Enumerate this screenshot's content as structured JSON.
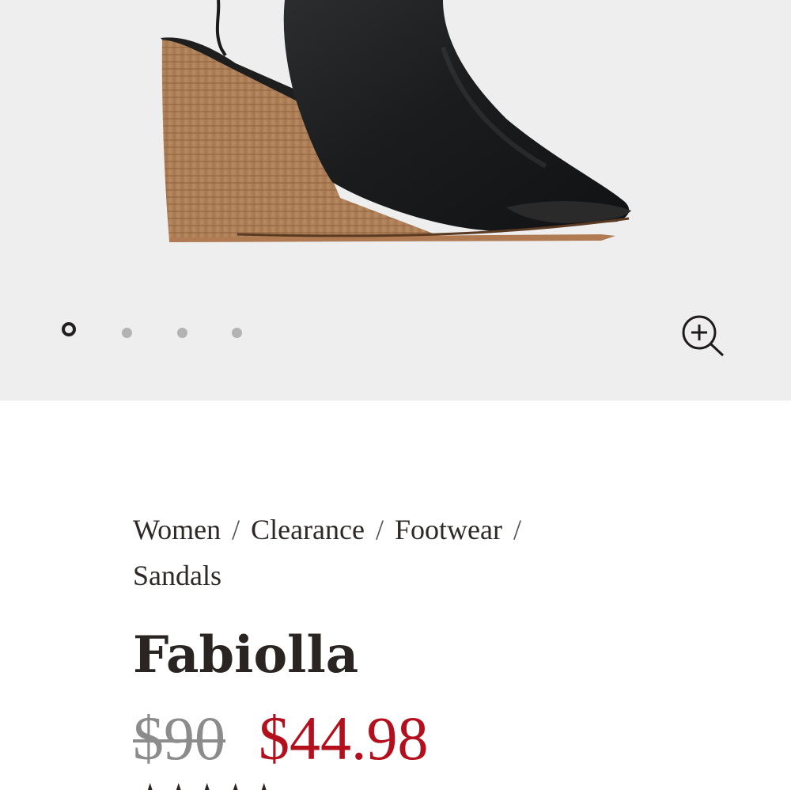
{
  "breadcrumb": {
    "items": [
      "Women",
      "Clearance",
      "Footwear",
      "Sandals"
    ],
    "separator": "/"
  },
  "product": {
    "name": "Fabiolla",
    "original_price": "$90",
    "sale_price": "$44.98",
    "rating_glyphs": [
      "★",
      "★",
      "★",
      "★",
      "★"
    ]
  },
  "gallery": {
    "image_count": 4,
    "active_index": 1
  },
  "icons": {
    "zoom": "zoom-in-icon"
  },
  "colors": {
    "gallery_background": "#efeeef",
    "sale_price": "#b40f1c",
    "original_price": "#8d8c8d",
    "text": "#2b2523"
  }
}
